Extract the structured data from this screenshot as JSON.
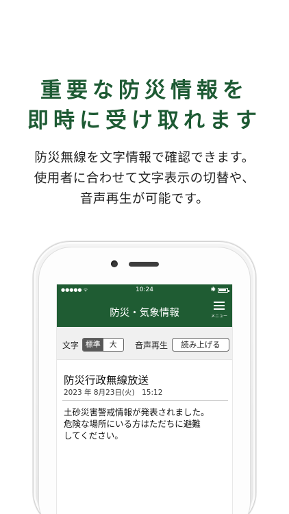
{
  "headline": {
    "line1": "重要な防災情報を",
    "line2": "即時に受け取れます"
  },
  "description": {
    "line1": "防災無線を文字情報で確認できます。",
    "line2": "使用者に合わせて文字表示の切替や、",
    "line3": "音声再生が可能です。"
  },
  "phone": {
    "status_bar": {
      "signal": "●●●●● ᯤ",
      "time": "10:24",
      "bluetooth": "✱"
    },
    "nav": {
      "title": "防災・気象情報",
      "menu_label": "メニュー",
      "menu_icon": "hamburger-icon"
    },
    "toolbar": {
      "text_label": "文字",
      "text_size_options": [
        "標準",
        "大"
      ],
      "text_size_selected": "標準",
      "voice_label": "音声再生",
      "read_button": "読み上げる"
    },
    "article": {
      "title": "防災行政無線放送",
      "date": "2023 年 8月23日(火)　15:12",
      "body_lines": [
        "土砂災害警戒情報が発表されました。",
        "危険な場所にいる方はただちに避難",
        "してください。"
      ]
    }
  },
  "colors": {
    "brand_green": "#1f5c33",
    "headline_green": "#1d5a33"
  }
}
